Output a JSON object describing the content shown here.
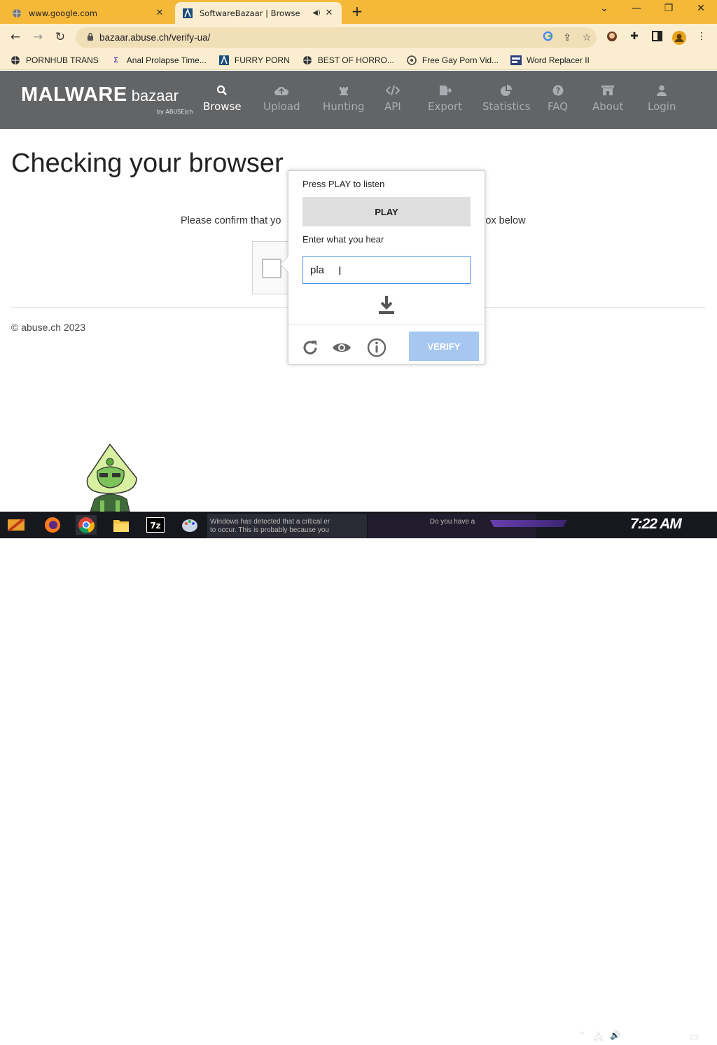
{
  "browser": {
    "tabs": [
      {
        "title": "www.google.com"
      },
      {
        "title": "SoftwareBazaar | Browse"
      }
    ],
    "url": "bazaar.abuse.ch/verify-ua/",
    "bookmarks": [
      {
        "label": "PORNHUB TRANS"
      },
      {
        "label": "Anal Prolapse Time..."
      },
      {
        "label": "FURRY PORN"
      },
      {
        "label": "BEST OF HORRO..."
      },
      {
        "label": "Free Gay Porn Vid..."
      },
      {
        "label": "Word Replacer II"
      }
    ]
  },
  "site": {
    "logo_main": "MALWARE",
    "logo_sub": "bazaar",
    "logo_by": "by ABUSE|ch",
    "nav": [
      {
        "label": "Browse",
        "icon": "search-icon"
      },
      {
        "label": "Upload",
        "icon": "cloud-upload-icon"
      },
      {
        "label": "Hunting",
        "icon": "chess-rook-icon"
      },
      {
        "label": "API",
        "icon": "code-icon"
      },
      {
        "label": "Export",
        "icon": "file-export-icon"
      },
      {
        "label": "Statistics",
        "icon": "pie-chart-icon"
      },
      {
        "label": "FAQ",
        "icon": "question-icon"
      },
      {
        "label": "About",
        "icon": "building-icon"
      },
      {
        "label": "Login",
        "icon": "user-icon"
      }
    ]
  },
  "page": {
    "heading": "Checking your browser",
    "confirm_left": "Please confirm that yo",
    "confirm_right": "kbox below",
    "footer": "© abuse.ch 2023"
  },
  "challenge": {
    "prompt": "Press PLAY to listen",
    "play_label": "PLAY",
    "answer_label": "Enter what you hear",
    "answer_value": "pla",
    "verify_label": "VERIFY"
  },
  "taskbar": {
    "notification_left": "Windows has detected that a critical er\nto occur. This is probably because you",
    "notification_right": "Do you have a",
    "clock": "7:22 AM"
  }
}
